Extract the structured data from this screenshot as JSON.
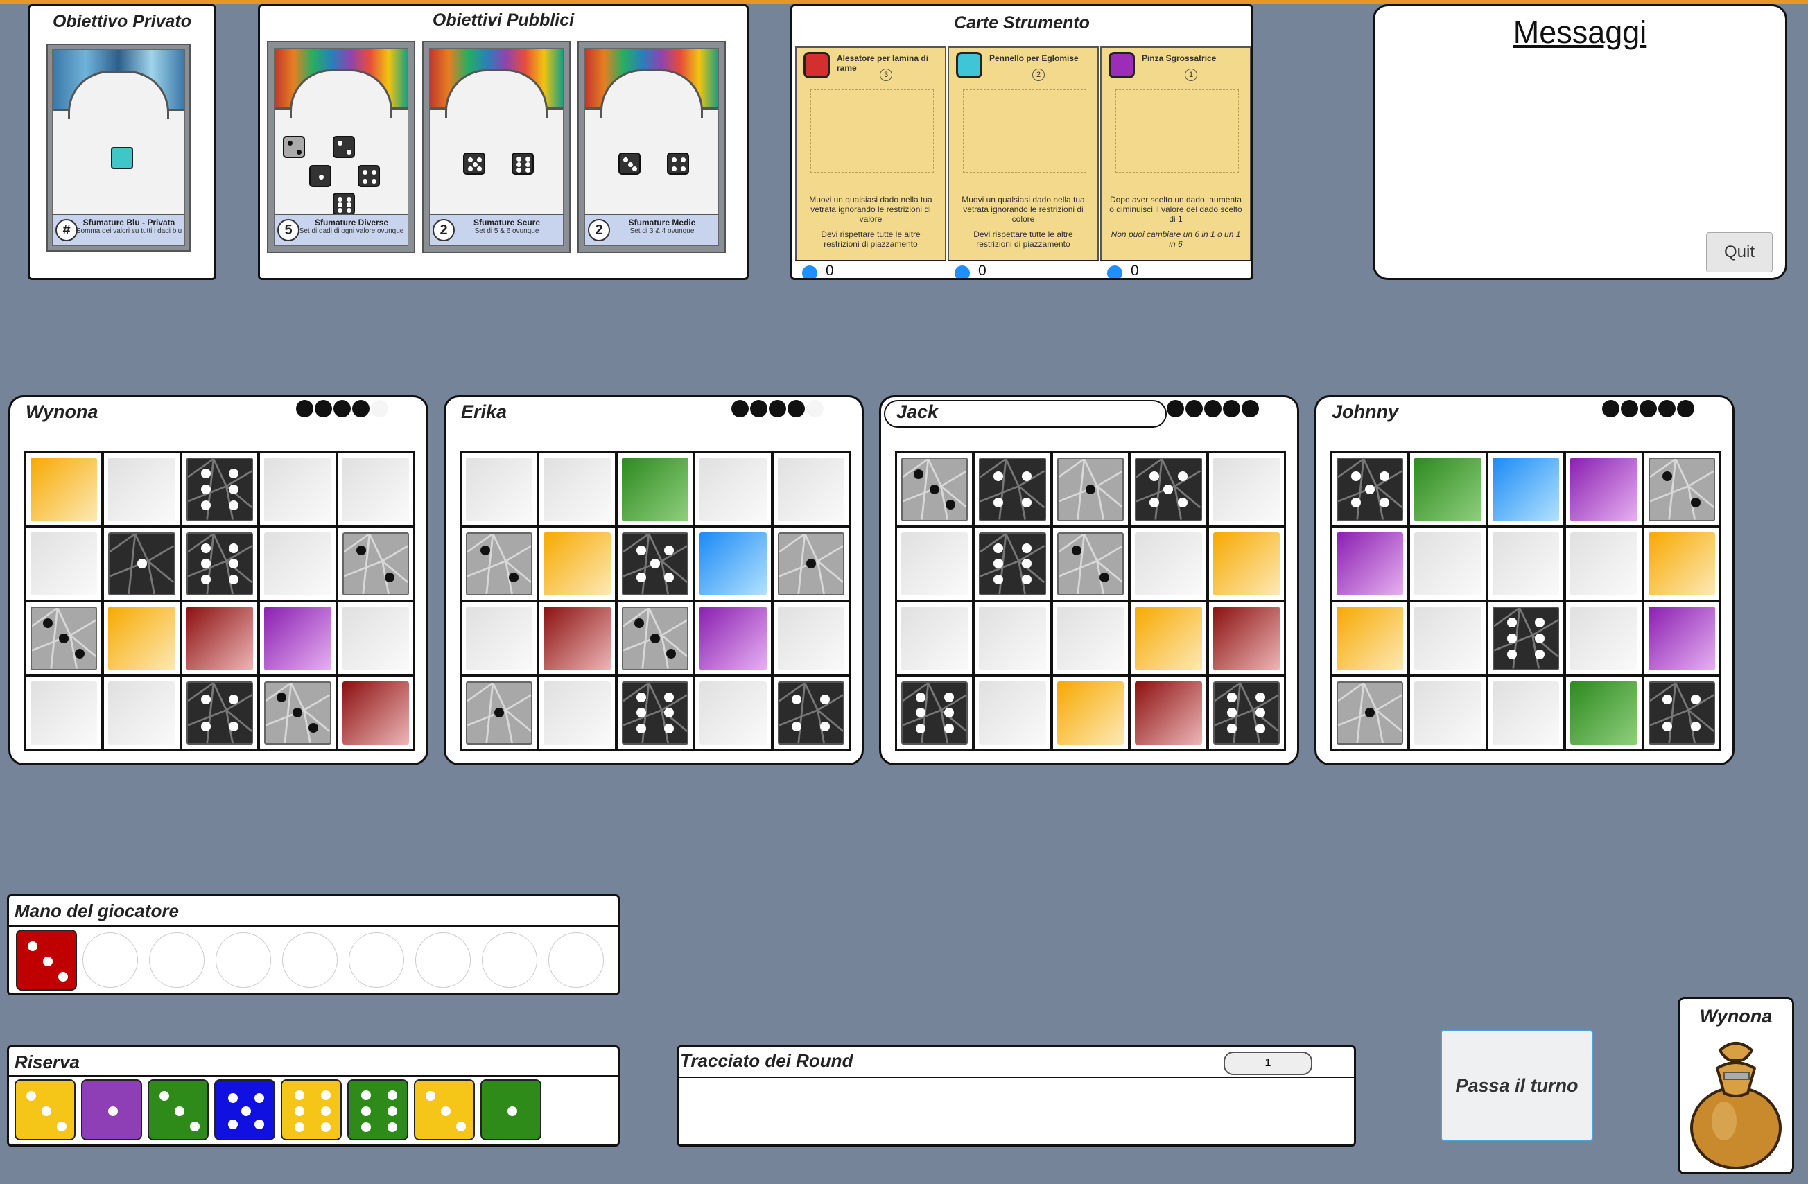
{
  "private_objective": {
    "title": "Obiettivo Privato",
    "card_title": "Sfumature Blu - Privata",
    "card_desc": "Somma dei valori su tutti i dadi blu",
    "score": "#"
  },
  "public_objectives": {
    "title": "Obiettivi Pubblici",
    "cards": [
      {
        "score": "5",
        "title": "Sfumature Diverse",
        "desc": "Set di dadi di ogni valore ovunque"
      },
      {
        "score": "2",
        "title": "Sfumature Scure",
        "desc": "Set di 5 & 6 ovunque"
      },
      {
        "score": "2",
        "title": "Sfumature Medie",
        "desc": "Set di 3 & 4 ovunque"
      }
    ]
  },
  "tools": {
    "title": "Carte Strumento",
    "cards": [
      {
        "name": "Alesatore per lamina di rame",
        "cost": "3",
        "color": "#d32f2f",
        "desc": "Muovi un qualsiasi dado nella tua vetrata ignorando le restrizioni di valore",
        "note": "Devi rispettare tutte le altre restrizioni di piazzamento",
        "tokens": "0"
      },
      {
        "name": "Pennello per Eglomise",
        "cost": "2",
        "color": "#3fc6d6",
        "desc": "Muovi un qualsiasi dado nella tua vetrata ignorando le restrizioni di colore",
        "note": "Devi rispettare tutte le altre restrizioni di piazzamento",
        "tokens": "0"
      },
      {
        "name": "Pinza Sgrossatrice",
        "cost": "1",
        "color": "#9b2db8",
        "desc": "Dopo aver scelto un dado, aumenta o diminuisci il valore del dado scelto di 1",
        "note": "Non puoi cambiare un 6 in 1 o un 1 in 6",
        "tokens": "0"
      }
    ]
  },
  "messages": {
    "title": "Messaggi",
    "quit_label": "Quit"
  },
  "players": [
    {
      "name": "Wynona",
      "tokens": [
        1,
        1,
        1,
        1,
        0
      ],
      "grid": [
        [
          "Y",
          "",
          "Sd6",
          "",
          ""
        ],
        [
          "",
          "Sd1",
          "Sd6",
          "",
          "Sl2"
        ],
        [
          "Sl3",
          "Y",
          "R",
          "P",
          ""
        ],
        [
          "",
          "",
          "Sd4",
          "Sl3",
          "R"
        ]
      ]
    },
    {
      "name": "Erika",
      "tokens": [
        1,
        1,
        1,
        1,
        0
      ],
      "grid": [
        [
          "",
          "",
          "G",
          "",
          ""
        ],
        [
          "Sl2",
          "Y",
          "Sd5",
          "B",
          "Sl1"
        ],
        [
          "",
          "R",
          "Sl3",
          "P",
          ""
        ],
        [
          "Sl1",
          "",
          "Sd6",
          "",
          "Sd4"
        ]
      ]
    },
    {
      "name": "Jack",
      "tokens": [
        1,
        1,
        1,
        1,
        1
      ],
      "grid": [
        [
          "Sl3",
          "Sd4",
          "Sl1",
          "Sd5",
          ""
        ],
        [
          "",
          "Sd6",
          "Sl2",
          "",
          "Y"
        ],
        [
          "",
          "",
          "",
          "Y",
          "R"
        ],
        [
          "Sd6",
          "",
          "Y",
          "R",
          "Sd6"
        ]
      ]
    },
    {
      "name": "Johnny",
      "tokens": [
        1,
        1,
        1,
        1,
        1
      ],
      "grid": [
        [
          "Sd5",
          "G",
          "B",
          "P",
          "Sl2"
        ],
        [
          "P",
          "",
          "",
          "",
          "Y"
        ],
        [
          "Y",
          "",
          "Sd6",
          "",
          "P"
        ],
        [
          "Sl1",
          "",
          "",
          "G",
          "Sd4"
        ]
      ]
    }
  ],
  "hand": {
    "title": "Mano del giocatore",
    "dice": [
      {
        "color": "#c00000",
        "value": 3
      }
    ],
    "empty_slots": 8
  },
  "reserve": {
    "title": "Riserva",
    "dice": [
      {
        "color": "#f5c518",
        "value": 3
      },
      {
        "color": "#8e3fb5",
        "value": 1
      },
      {
        "color": "#2e8b1a",
        "value": 3
      },
      {
        "color": "#1010e0",
        "value": 5
      },
      {
        "color": "#f5c518",
        "value": 6
      },
      {
        "color": "#2e8b1a",
        "value": 6
      },
      {
        "color": "#f5c518",
        "value": 3
      },
      {
        "color": "#2e8b1a",
        "value": 1
      }
    ]
  },
  "round_track": {
    "title": "Tracciato dei Round",
    "round": "1"
  },
  "pass_button": "Passa il turno",
  "bag": {
    "player": "Wynona"
  }
}
